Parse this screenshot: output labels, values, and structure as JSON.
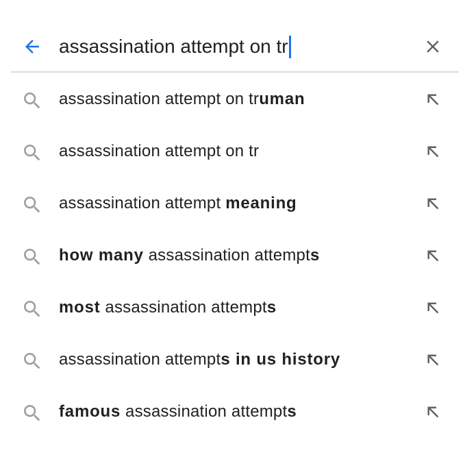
{
  "search": {
    "query": "assassination attempt on tr",
    "accent_color": "#1a73e8",
    "back_icon": "arrow-left-icon",
    "clear_icon": "close-icon"
  },
  "suggestions": [
    {
      "parts": [
        {
          "text": "assassination attempt on tr",
          "bold": false
        },
        {
          "text": "uman",
          "bold": true
        }
      ]
    },
    {
      "parts": [
        {
          "text": "assassination attempt on tr",
          "bold": false
        }
      ]
    },
    {
      "parts": [
        {
          "text": "assassination attempt ",
          "bold": false
        },
        {
          "text": "meaning",
          "bold": true
        }
      ]
    },
    {
      "parts": [
        {
          "text": "how many",
          "bold": true
        },
        {
          "text": " assassination attempt",
          "bold": false
        },
        {
          "text": "s",
          "bold": true
        }
      ]
    },
    {
      "parts": [
        {
          "text": "most",
          "bold": true
        },
        {
          "text": " assassination attempt",
          "bold": false
        },
        {
          "text": "s",
          "bold": true
        }
      ]
    },
    {
      "parts": [
        {
          "text": "assassination attempt",
          "bold": false
        },
        {
          "text": "s in us history",
          "bold": true
        }
      ]
    },
    {
      "parts": [
        {
          "text": "famous",
          "bold": true
        },
        {
          "text": " assassination attempt",
          "bold": false
        },
        {
          "text": "s",
          "bold": true
        }
      ]
    }
  ],
  "suggestion_icon": "search-icon",
  "fill_icon": "arrow-up-left-icon"
}
